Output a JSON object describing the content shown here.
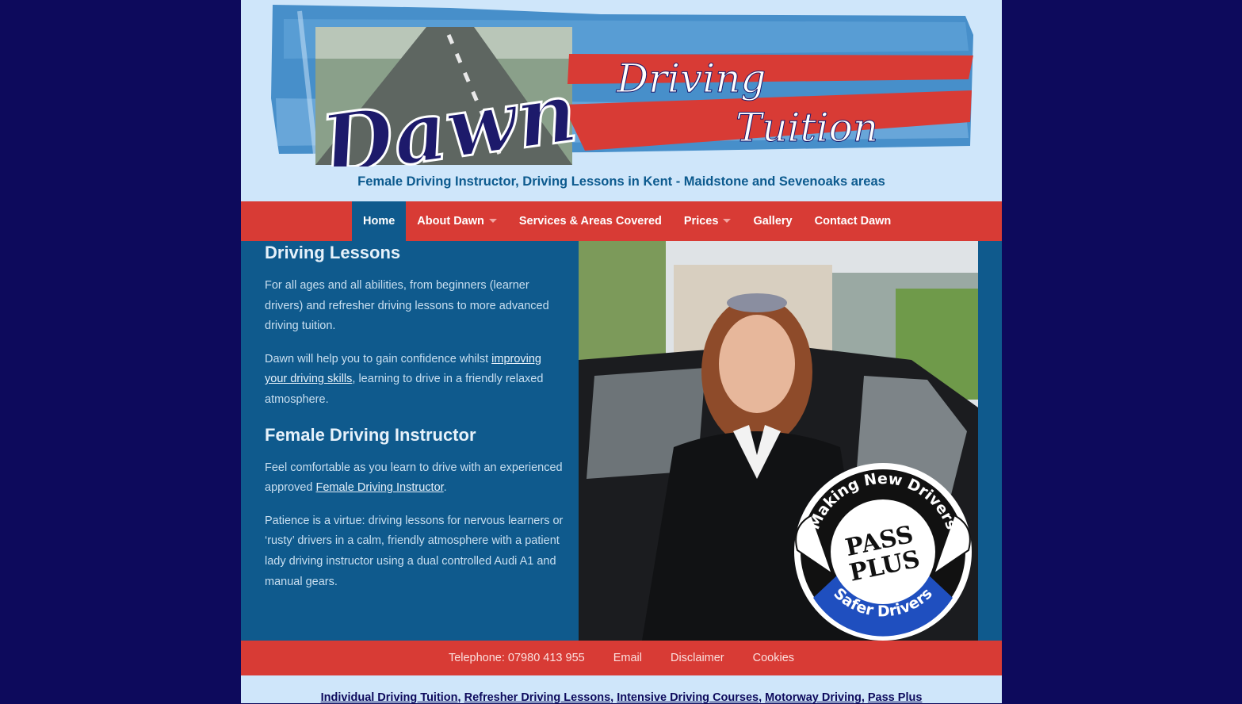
{
  "header": {
    "logo": {
      "word1": "Dawn",
      "word2": "Driving",
      "word3": "Tuition"
    },
    "tagline": "Female Driving Instructor, Driving Lessons in Kent - Maidstone and Sevenoaks areas"
  },
  "nav": {
    "items": [
      {
        "label": "Home",
        "active": true
      },
      {
        "label": "About Dawn",
        "dropdown": true
      },
      {
        "label": "Services & Areas Covered"
      },
      {
        "label": "Prices",
        "dropdown": true
      },
      {
        "label": "Gallery"
      },
      {
        "label": "Contact Dawn"
      }
    ]
  },
  "main": {
    "heading1": "Driving Lessons",
    "p1": "For all ages and all abilities, from beginners (learner drivers) and refresher driving lessons to more advanced driving tuition.",
    "p2_pre": "Dawn will help you to gain confidence whilst ",
    "p2_link": "improving your driving skills",
    "p2_post": ", learning to drive in a friendly relaxed atmosphere.",
    "heading2": "Female Driving Instructor",
    "p3_pre": "Feel comfortable as you learn to drive with an experienced approved ",
    "p3_link": "Female Driving Instructor",
    "p3_post": ".",
    "p4": "Patience is a virtue: driving lessons for nervous learners or ‘rusty’ drivers in a calm, friendly atmosphere with a patient lady driving instructor using a dual controlled Audi A1 and manual gears."
  },
  "badge": {
    "top_text": "Making New Drivers",
    "line1": "PASS",
    "line2": "PLUS",
    "bottom_text": "Safer Drivers"
  },
  "footer": {
    "telephone": "Telephone: 07980 413 955",
    "email": "Email",
    "disclaimer": "Disclaimer",
    "cookies": "Cookies"
  },
  "bottom_links": [
    "Individual Driving Tuition",
    "Refresher Driving Lessons",
    "Intensive Driving Courses",
    "Motorway Driving",
    "Pass Plus"
  ],
  "colors": {
    "background": "#0d0a5c",
    "header_bg": "#cfe6fa",
    "nav_bg": "#d83b35",
    "content_bg": "#0f5a8d",
    "tagline": "#0c5a8e"
  }
}
